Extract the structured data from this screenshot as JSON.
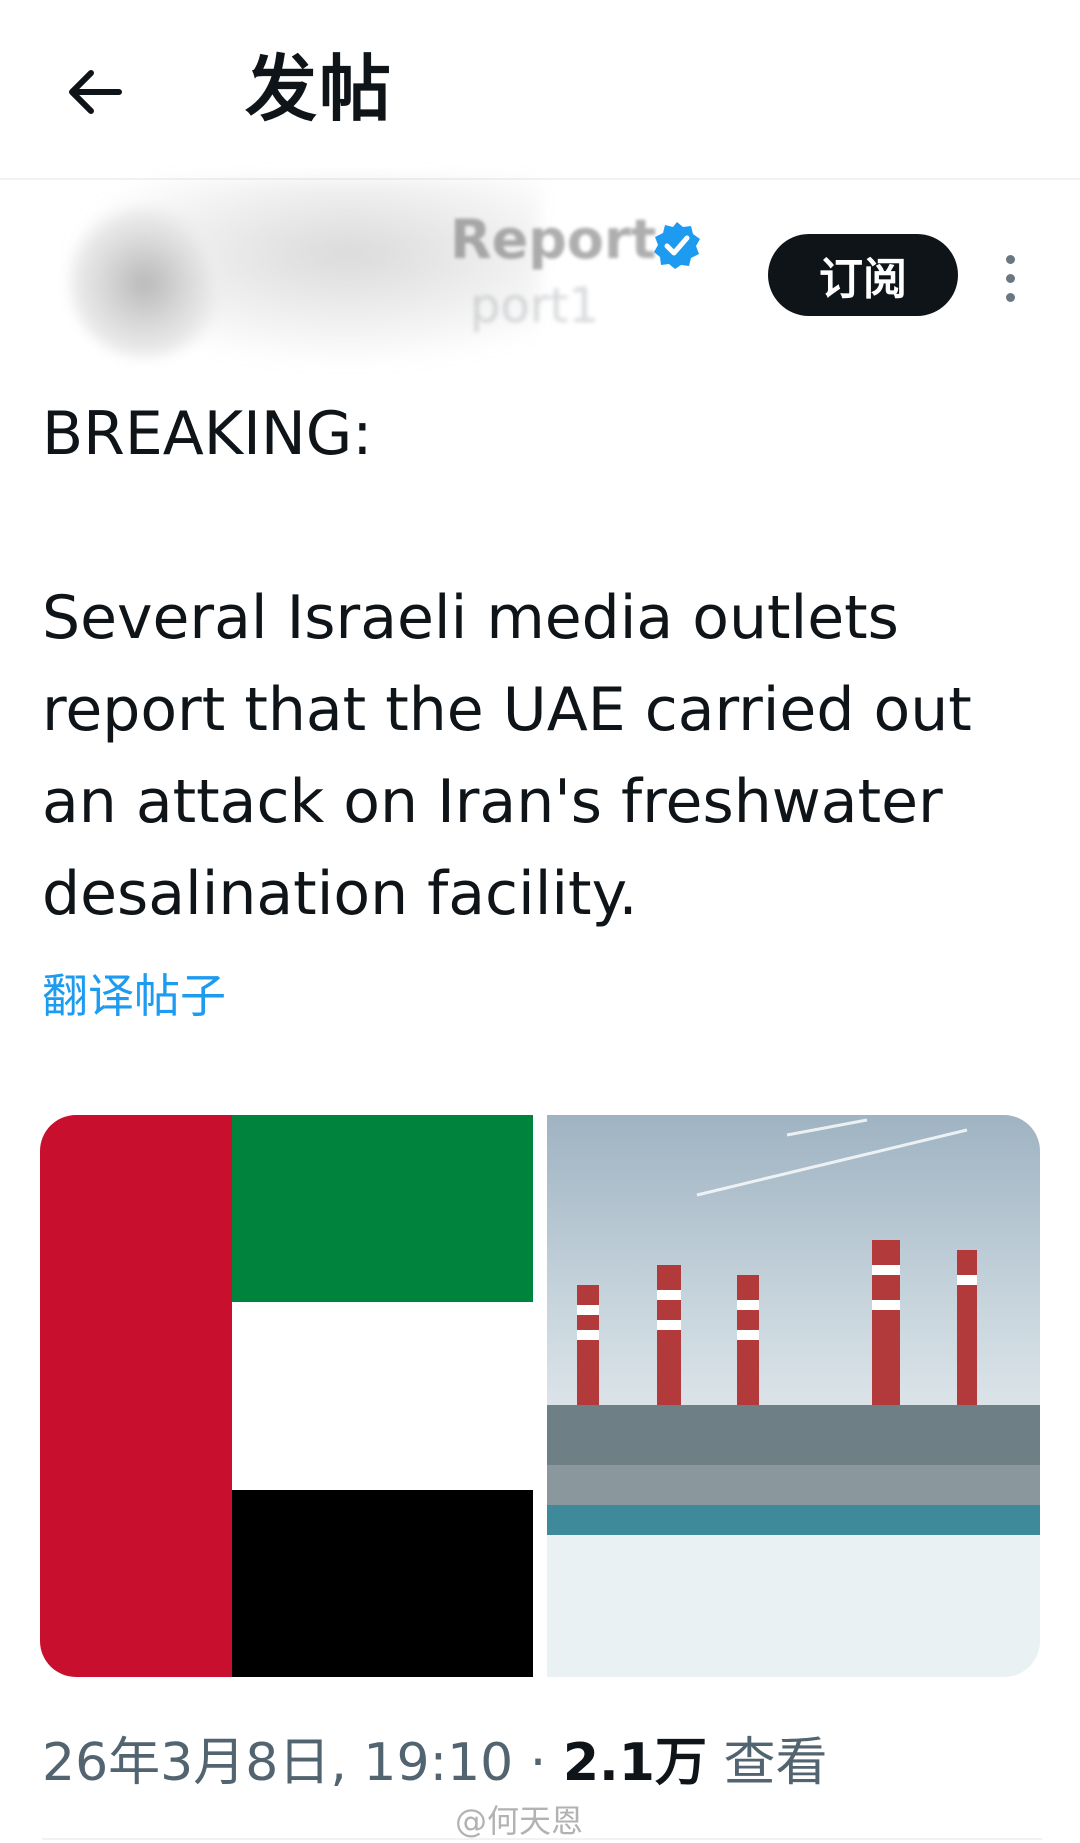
{
  "header": {
    "back_icon": "arrow-left-icon",
    "title": "发帖"
  },
  "author": {
    "name": "Report",
    "handle": "port1",
    "verified": true,
    "verified_color": "#1d9bf0",
    "subscribe_label": "订阅",
    "more_icon": "more-vertical-icon"
  },
  "post": {
    "breaking": "BREAKING:",
    "body": "Several Israeli media outlets report that the UAE carried out an attack on Iran's freshwater desalination facility.",
    "translate_label": "翻译帖子"
  },
  "media": {
    "images": [
      {
        "name": "uae-flag-image",
        "colors": [
          "#c8102e",
          "#00843d",
          "#ffffff",
          "#000000"
        ]
      },
      {
        "name": "desalination-plant-photo"
      }
    ]
  },
  "meta": {
    "timestamp": "26年3月8日, 19:10",
    "separator": "·",
    "views_count": "2.1万",
    "views_label": "查看"
  },
  "watermark": "@何天恩",
  "colors": {
    "link": "#1d9bf0",
    "text": "#0f1419",
    "secondary": "#536471"
  }
}
